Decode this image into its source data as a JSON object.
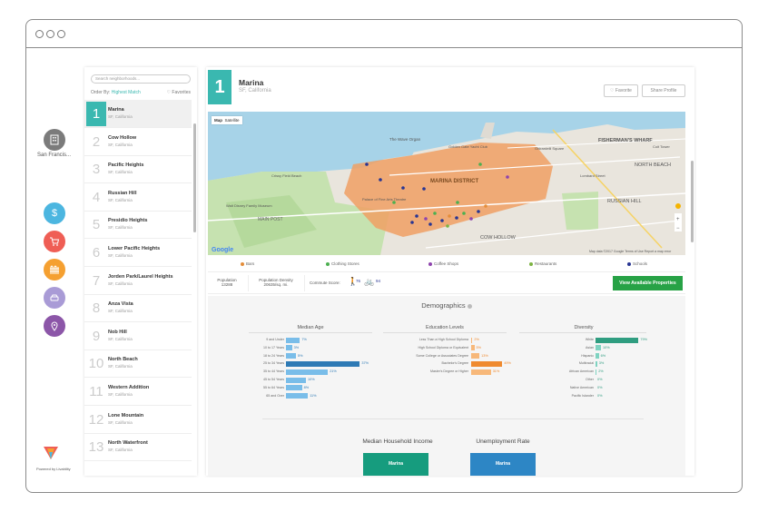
{
  "window": {
    "dots": 3
  },
  "rail": {
    "city_label": "San Francis...",
    "icons": [
      {
        "name": "building-icon",
        "color": "#7b7b7b"
      },
      {
        "name": "dollar-icon",
        "color": "#4cb6e0"
      },
      {
        "name": "cart-icon",
        "color": "#ef5e55"
      },
      {
        "name": "fence-icon",
        "color": "#f5a031"
      },
      {
        "name": "car-icon",
        "color": "#a99bd6"
      },
      {
        "name": "location-icon",
        "color": "#8c56a8"
      }
    ],
    "powered_by": "Powered by Livability"
  },
  "list": {
    "search_placeholder": "Search neighborhoods...",
    "order_by_label": "Order By:",
    "order_by_value": "Highest Match",
    "favorites_label": "♡ Favorites",
    "items": [
      {
        "rank": "1",
        "name": "Marina",
        "city": "SF, California"
      },
      {
        "rank": "2",
        "name": "Cow Hollow",
        "city": "SF, California"
      },
      {
        "rank": "3",
        "name": "Pacific Heights",
        "city": "SF, California"
      },
      {
        "rank": "4",
        "name": "Russian Hill",
        "city": "SF, California"
      },
      {
        "rank": "5",
        "name": "Presidio Heights",
        "city": "SF, California"
      },
      {
        "rank": "6",
        "name": "Lower Pacific Heights",
        "city": "SF, California"
      },
      {
        "rank": "7",
        "name": "Jorden Park/Laurel Heights",
        "city": "SF, California"
      },
      {
        "rank": "8",
        "name": "Anza Vista",
        "city": "SF, California"
      },
      {
        "rank": "9",
        "name": "Nob Hill",
        "city": "SF, California"
      },
      {
        "rank": "10",
        "name": "North Beach",
        "city": "SF, California"
      },
      {
        "rank": "11",
        "name": "Western Addition",
        "city": "SF, California"
      },
      {
        "rank": "12",
        "name": "Lone Mountain",
        "city": "SF, California"
      },
      {
        "rank": "13",
        "name": "North Waterfront",
        "city": "SF, California"
      }
    ]
  },
  "detail": {
    "rank": "1",
    "name": "Marina",
    "city": "SF, California",
    "favorite_label": "♡ Favorite",
    "share_label": "Share Profile",
    "map": {
      "map_btn": "Map",
      "satellite_btn": "Satellite",
      "labels": [
        "The Wave Organ",
        "MARINA DISTRICT",
        "Palace of Fine Arts Theatre",
        "MAIN POST",
        "FISHERMAN'S WHARF",
        "NORTH BEACH",
        "RUSSIAN HILL",
        "COW HOLLOW",
        "Golden Gate Yacht Club",
        "Walt Disney Family Museum",
        "Ghirardelli Square",
        "Lombard Street",
        "Crissy Field Beach",
        "Coit Tower"
      ],
      "google": "Google",
      "footer": "Map data ©2017 Google   Terms of Use   Report a map error"
    },
    "legend": [
      {
        "label": "Bars",
        "color": "#e48d3a"
      },
      {
        "label": "Clothing Stores",
        "color": "#4caf50"
      },
      {
        "label": "Coffee Shops",
        "color": "#8e44ad"
      },
      {
        "label": "Restaurants",
        "color": "#7cb342"
      },
      {
        "label": "Schools",
        "color": "#283593"
      }
    ],
    "stats": {
      "population_label": "Population",
      "population_value": "13288",
      "density_label": "Population Density",
      "density_value": "20635/sq. mi.",
      "commute_label": "Commute Score:",
      "walk_score": "76",
      "bike_score": "94"
    },
    "view_btn": "View Available Properties",
    "demographics": {
      "title": "Demographics",
      "median_age": {
        "title": "Median Age",
        "color": "#79bde9",
        "highlight": "#2e7ab5",
        "rows": [
          {
            "label": "9 and Under",
            "value": "7%",
            "pct": 7
          },
          {
            "label": "10 to 17 Years",
            "value": "3%",
            "pct": 3
          },
          {
            "label": "18 to 24 Years",
            "value": "5%",
            "pct": 5
          },
          {
            "label": "25 to 34 Years",
            "value": "37%",
            "pct": 37
          },
          {
            "label": "35 to 44 Years",
            "value": "21%",
            "pct": 21
          },
          {
            "label": "45 to 54 Years",
            "value": "10%",
            "pct": 10
          },
          {
            "label": "55 to 64 Years",
            "value": "8%",
            "pct": 8
          },
          {
            "label": "65 and Over",
            "value": "11%",
            "pct": 11
          }
        ]
      },
      "education": {
        "title": "Education Levels",
        "color": "#f7b87a",
        "highlight": "#ef8a2f",
        "rows": [
          {
            "label": "Less Than a High School Diploma",
            "value": "2%",
            "pct": 2
          },
          {
            "label": "High School Diploma or Equivalent",
            "value": "5%",
            "pct": 5
          },
          {
            "label": "Some College or Associates Degree",
            "value": "13%",
            "pct": 13
          },
          {
            "label": "Bachelor's Degree",
            "value": "49%",
            "pct": 49
          },
          {
            "label": "Master's Degree or Higher",
            "value": "31%",
            "pct": 31
          }
        ]
      },
      "diversity": {
        "title": "Diversity",
        "color": "#7fd3c1",
        "highlight": "#2f9d80",
        "rows": [
          {
            "label": "White",
            "value": "79%",
            "pct": 79
          },
          {
            "label": "Asian",
            "value": "10%",
            "pct": 10
          },
          {
            "label": "Hispanic",
            "value": "6%",
            "pct": 6
          },
          {
            "label": "Multiracial",
            "value": "3%",
            "pct": 3
          },
          {
            "label": "African American",
            "value": "2%",
            "pct": 2
          },
          {
            "label": "Other",
            "value": "0%",
            "pct": 0
          },
          {
            "label": "Native American",
            "value": "0%",
            "pct": 0
          },
          {
            "label": "Pacific Islander",
            "value": "0%",
            "pct": 0
          }
        ]
      },
      "income_title": "Median Household Income",
      "income_box": "Marina",
      "unemployment_title": "Unemployment Rate",
      "unemployment_box": "Marina"
    }
  }
}
